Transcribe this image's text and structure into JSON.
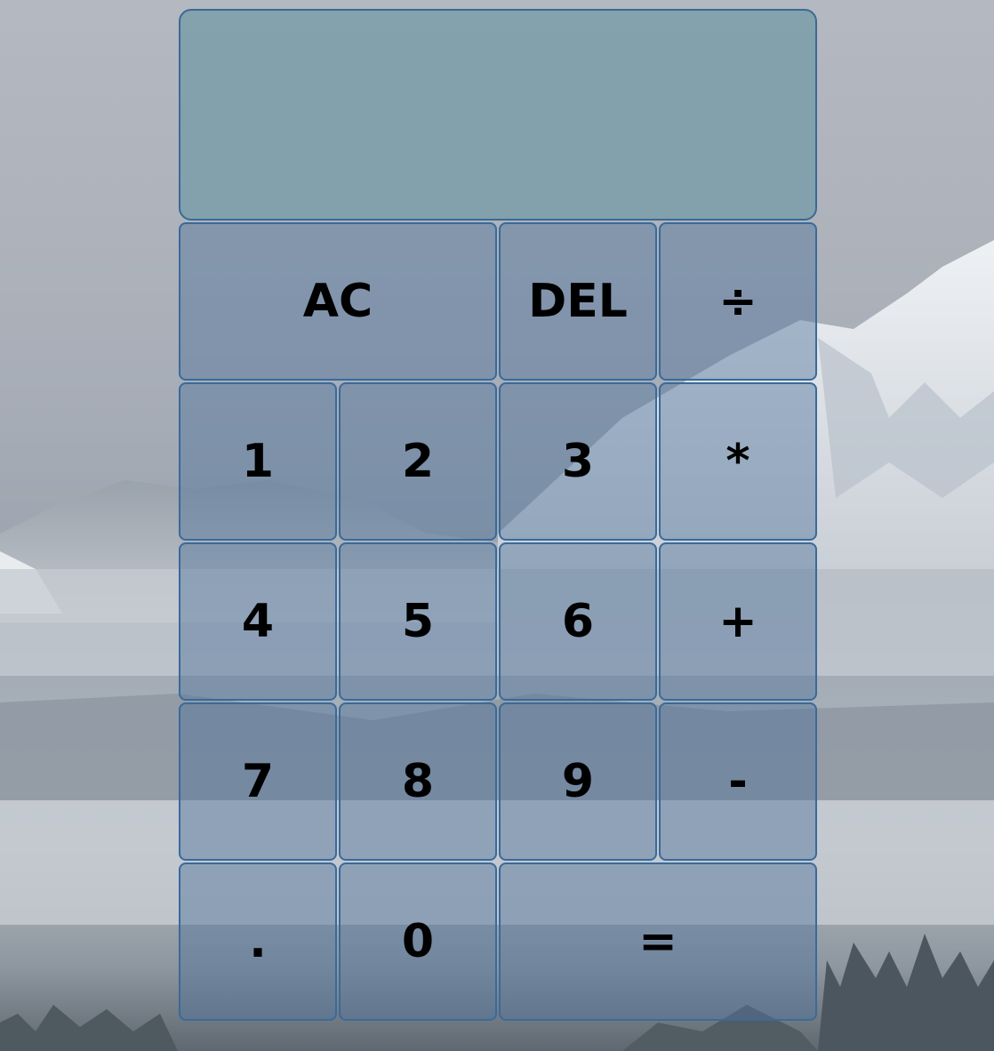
{
  "display": {
    "previous_operand": "",
    "current_operand": ""
  },
  "keys": {
    "all_clear": "AC",
    "delete": "DEL",
    "divide": "÷",
    "one": "1",
    "two": "2",
    "three": "3",
    "multiply": "*",
    "four": "4",
    "five": "5",
    "six": "6",
    "add": "+",
    "seven": "7",
    "eight": "8",
    "nine": "9",
    "subtract": "-",
    "decimal": ".",
    "zero": "0",
    "equals": "="
  },
  "colors": {
    "display_bg": "#7c9eaa",
    "key_bg": "#50739b",
    "border": "#3a6a9a",
    "key_text": "#000000"
  }
}
